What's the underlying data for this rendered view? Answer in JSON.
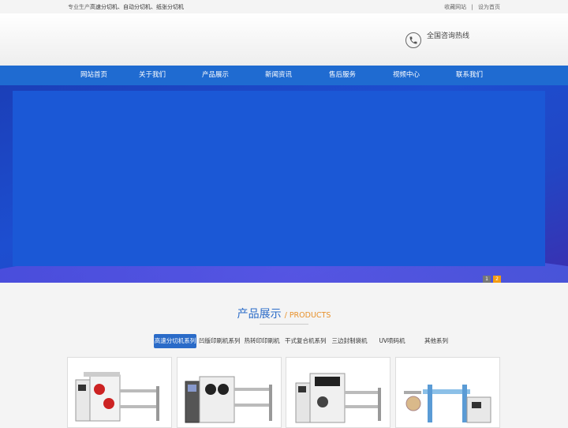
{
  "topbar": {
    "prefix": "专业生产",
    "products": "高速分切机、自动分切机、纸张分切机",
    "bookmark": "收藏网站",
    "separator": "|",
    "homepage": "设为首页"
  },
  "header": {
    "hotline_label": "全国咨询热线",
    "phone_icon": "phone-icon"
  },
  "nav": {
    "items": [
      "网站首页",
      "关于我们",
      "产品展示",
      "新闻资讯",
      "售后服务",
      "视频中心",
      "联系我们"
    ]
  },
  "banner": {
    "pages": [
      "1",
      "2"
    ],
    "active_page": "2"
  },
  "products": {
    "title_cn": "产品展示",
    "title_en": "/ PRODUCTS",
    "tabs": [
      "高速分切机系列",
      "凹版印刷机系列",
      "热转印印刷机",
      "干式复合机系列",
      "三边封制袋机",
      "UV喷码机",
      "其他系列"
    ],
    "active_tab": "高速分切机系列"
  },
  "colors": {
    "nav": "#1f6bd1",
    "accent": "#2a6bc8",
    "en_title": "#e8912b",
    "active_dot": "#f39c12"
  }
}
